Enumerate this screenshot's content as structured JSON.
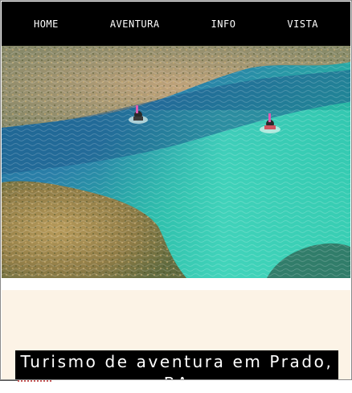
{
  "nav": {
    "items": [
      {
        "label": "HOME"
      },
      {
        "label": "AVENTURA"
      },
      {
        "label": "INFO"
      },
      {
        "label": "VISTA"
      }
    ]
  },
  "hero": {
    "icon": "snorkeling-reef-photo"
  },
  "banner": {
    "title": "Turismo de aventura em Prado, BA"
  },
  "colors": {
    "nav_bg": "#000000",
    "nav_text": "#ffffff",
    "content_bg": "#fcf3e6",
    "water": "#2fb8a8",
    "reef": "#8a7a3a"
  }
}
